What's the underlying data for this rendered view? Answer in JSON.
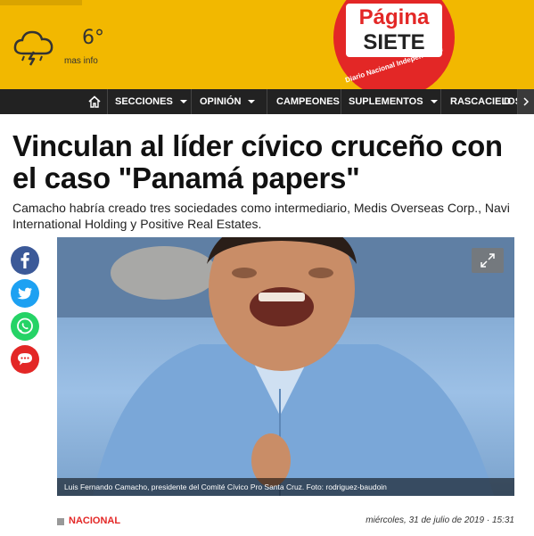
{
  "header": {
    "weather": {
      "icon": "storm-cloud-icon",
      "temperature": "6°",
      "more_label": "mas info"
    },
    "logo": {
      "line1": "Página",
      "line2": "SIETE",
      "tagline": "Diario Nacional Independiente"
    },
    "brand_color": "#e32726",
    "bar_color": "#f2b800"
  },
  "nav": {
    "home_icon": "home-icon",
    "items": [
      {
        "label": "SECCIONES",
        "dropdown": true
      },
      {
        "label": "OPINIÓN",
        "dropdown": true
      },
      {
        "label": "CAMPEONES",
        "dropdown": false
      },
      {
        "label": "SUPLEMENTOS",
        "dropdown": true
      },
      {
        "label": "RASCACIELOS",
        "dropdown": false
      },
      {
        "label": "D",
        "dropdown": false
      }
    ]
  },
  "article": {
    "headline": "Vinculan al líder cívico cruceño con el caso \"Panamá papers\"",
    "subtitle": "Camacho habría creado tres sociedades como intermediario, Medis Overseas Corp., Navi International Holding y Positive Real Estates.",
    "image_caption": "Luis Fernando Camacho, presidente del Comité Cívico Pro Santa Cruz. Foto: rodriguez-baudoin",
    "section": "NACIONAL",
    "date": "miércoles, 31 de julio de 2019 · 15:31"
  },
  "share": [
    {
      "icon": "facebook-icon",
      "color": "#3b5998"
    },
    {
      "icon": "twitter-icon",
      "color": "#1da1f2"
    },
    {
      "icon": "whatsapp-icon",
      "color": "#25d366"
    },
    {
      "icon": "comment-icon",
      "color": "#e32726"
    }
  ]
}
